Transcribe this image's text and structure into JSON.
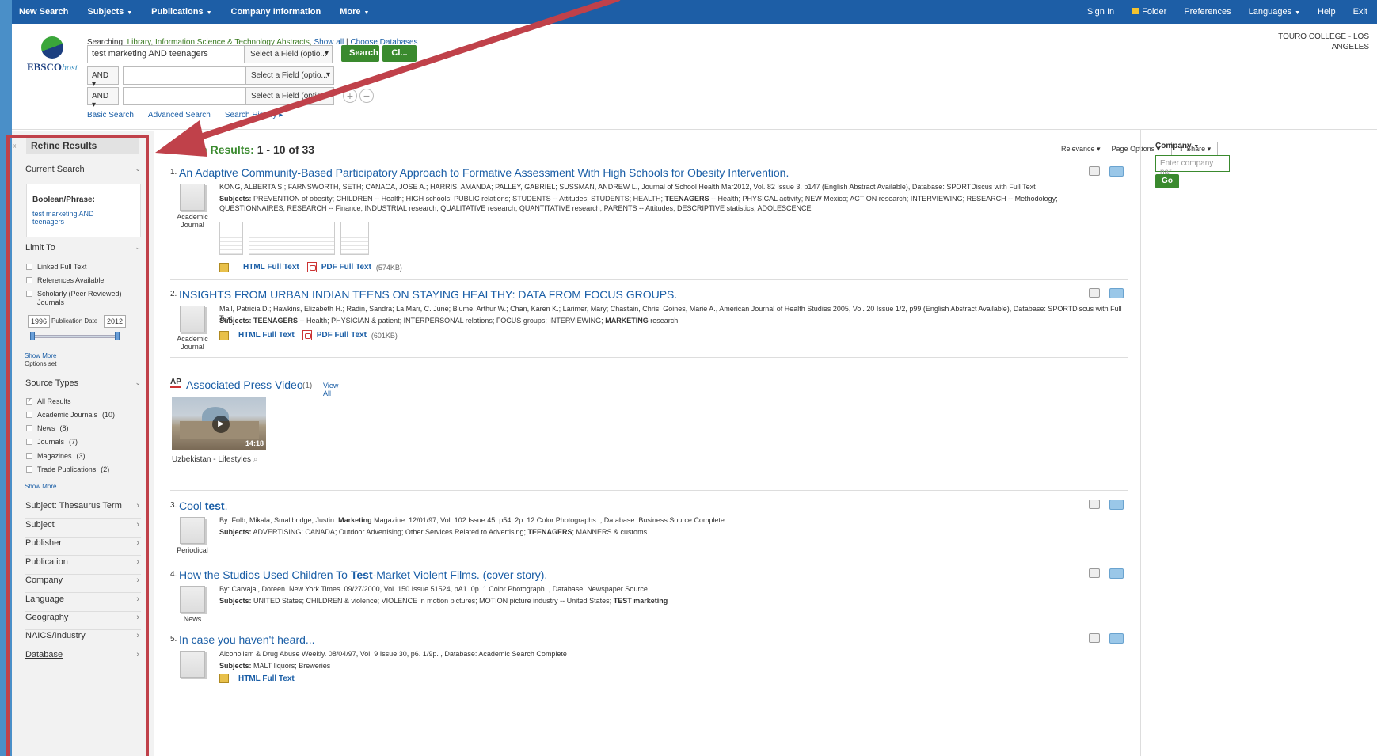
{
  "topnav": {
    "left": [
      "New Search",
      "Subjects",
      "Publications",
      "Company Information",
      "More"
    ],
    "right": [
      "Sign In",
      "Folder",
      "Preferences",
      "Languages",
      "Help",
      "Exit"
    ]
  },
  "logo": {
    "brand": "EBSCO",
    "suffix": "host"
  },
  "searching": {
    "label": "Searching:",
    "db": "Library, Information Science & Technology Abstracts,",
    "show_all": "Show all",
    "choose": "Choose Databases"
  },
  "search": {
    "rows": [
      {
        "value": "test marketing AND teenagers",
        "field": "Select a Field (optio..."
      },
      {
        "bool": "AND ▾",
        "value": "",
        "field": "Select a Field (optio..."
      },
      {
        "bool": "AND ▾",
        "value": "",
        "field": "Select a Field (optio..."
      }
    ],
    "search_btn": "Search",
    "clear_btn": "Cl..."
  },
  "search_links": [
    "Basic Search",
    "Advanced Search",
    "Search History"
  ],
  "org": "TOURO COLLEGE - LOS ANGELES",
  "sidebar": {
    "refine": "Refine Results",
    "current_search": "Current Search",
    "boolean_label": "Boolean/Phrase:",
    "boolean_value": "test marketing AND teenagers",
    "limit_to": "Limit To",
    "limits": [
      "Linked Full Text",
      "References Available",
      "Scholarly (Peer Reviewed) Journals"
    ],
    "date_from": "1996",
    "date_label": "Publication Date",
    "date_to": "2012",
    "show_more_1": "Show More",
    "options_set": "Options set",
    "source_types": "Source Types",
    "sources": [
      {
        "label": "All Results",
        "count": ""
      },
      {
        "label": "Academic Journals",
        "count": "(10)"
      },
      {
        "label": "News",
        "count": "(8)"
      },
      {
        "label": "Journals",
        "count": "(7)"
      },
      {
        "label": "Magazines",
        "count": "(3)"
      },
      {
        "label": "Trade Publications",
        "count": "(2)"
      }
    ],
    "show_more_2": "Show More",
    "facets": [
      "Subject: Thesaurus Term",
      "Subject",
      "Publisher",
      "Publication",
      "Company",
      "Language",
      "Geography",
      "NAICS/Industry",
      "Database"
    ]
  },
  "results": {
    "heading": "Search Results:",
    "range": "1 - 10 of 33",
    "tools": [
      "Relevance ▾",
      "Page Options ▾",
      "Share ▾"
    ],
    "records": [
      {
        "num": "1.",
        "title": "An Adaptive Community-Based Participatory Approach to Formative Assessment With High Schools for Obesity Intervention.",
        "meta": "KONG, ALBERTA S.; FARNSWORTH, SETH; CANACA, JOSE A.; HARRIS, AMANDA; PALLEY, GABRIEL; SUSSMAN, ANDREW L., Journal of School Health Mar2012, Vol. 82 Issue 3, p147 (English Abstract Available), Database: SPORTDiscus with Full Text",
        "subjects_label": "Subjects:",
        "subjects_a": "PREVENTION of obesity; CHILDREN -- Health; HIGH schools; PUBLIC relations; STUDENTS -- Attitudes; STUDENTS; HEALTH;",
        "subjects_b": "TEENAGERS",
        "subjects_c": "-- Health; PHYSICAL activity; NEW Mexico; ACTION research; INTERVIEWING; RESEARCH -- Methodology; QUESTIONNAIRES; RESEARCH -- Finance; INDUSTRIAL research; QUALITATIVE research; QUANTITATIVE research; PARENTS -- Attitudes; DESCRIPTIVE statistics; ADOLESCENCE",
        "type": "Academic Journal",
        "html": "HTML Full Text",
        "pdf": "PDF Full Text",
        "pdf_size": "(574KB)"
      },
      {
        "num": "2.",
        "title": "INSIGHTS FROM URBAN INDIAN TEENS ON STAYING HEALTHY: DATA FROM FOCUS GROUPS.",
        "meta": "Mail, Patricia D.; Hawkins, Elizabeth H.; Radin, Sandra; La Marr, C. June; Blume, Arthur W.; Chan, Karen K.; Larimer, Mary; Chastain, Chris; Goines, Marie A., American Journal of Health Studies 2005, Vol. 20 Issue 1/2, p99 (English Abstract Available), Database: SPORTDiscus with Full Text",
        "subjects_label": "Subjects:",
        "subjects_b": "TEENAGERS",
        "subjects_a": "-- Health; PHYSICIAN & patient; INTERPERSONAL relations; FOCUS groups; INTERVIEWING;",
        "subjects_d": "MARKETING",
        "subjects_c": "research",
        "type": "Academic Journal",
        "html": "HTML Full Text",
        "pdf": "PDF Full Text",
        "pdf_size": "(601KB)"
      },
      {
        "num": "3.",
        "title_a": "Cool ",
        "title_b": "test",
        "title_c": ".",
        "meta_a": "By: Folb, Mikala; Smallbridge, Justin.",
        "meta_b": "Marketing",
        "meta_c": "Magazine. 12/01/97, Vol. 102 Issue 45, p54. 2p. 12 Color Photographs. , Database: Business Source Complete",
        "subjects_label": "Subjects:",
        "subjects_a": "ADVERTISING; CANADA; Outdoor Advertising; Other Services Related to Advertising;",
        "subjects_b": "TEENAGERS",
        "subjects_c": "; MANNERS & customs",
        "type": "Periodical"
      },
      {
        "num": "4.",
        "title_a": "How the Studios Used Children To ",
        "title_b": "Test",
        "title_c": "-Market Violent Films. (cover story).",
        "meta": "By: Carvajal, Doreen. New York Times. 09/27/2000, Vol. 150 Issue 51524, pA1. 0p. 1 Color Photograph. , Database: Newspaper Source",
        "subjects_label": "Subjects:",
        "subjects_a": "UNITED States; CHILDREN & violence; VIOLENCE in motion pictures; MOTION picture industry -- United States;",
        "subjects_b": "TEST marketing",
        "type": "News"
      },
      {
        "num": "5.",
        "title": "In case you haven't heard...",
        "meta": "Alcoholism & Drug Abuse Weekly. 08/04/97, Vol. 9 Issue 30, p6. 1/9p. , Database: Academic Search Complete",
        "subjects_label": "Subjects:",
        "subjects_a": "MALT liquors; Breweries",
        "html": "HTML Full Text"
      }
    ]
  },
  "ap": {
    "logo": "AP",
    "title": "Associated Press Video",
    "count": "(1)",
    "view_all": "View All",
    "duration": "14:18",
    "caption": "Uzbekistan - Lifestyles"
  },
  "rside": {
    "heading": "Company",
    "placeholder": "Enter company nar",
    "go": "Go"
  },
  "colors": {
    "nav": "#1d5ea6",
    "green": "#3a8a2e",
    "link": "#1a5ea6",
    "annotation": "#c0414a"
  }
}
